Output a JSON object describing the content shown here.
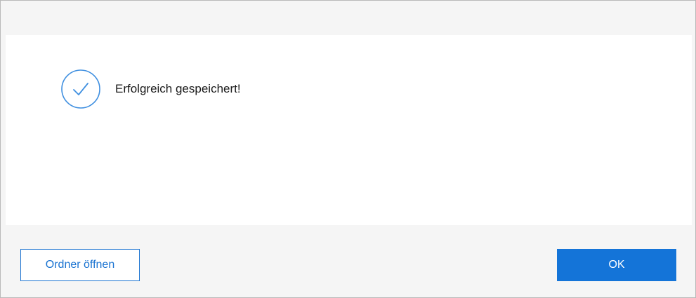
{
  "dialog": {
    "message": "Erfolgreich gespeichert!",
    "status_icon": "checkmark-circle-icon",
    "accent_color": "#1474d8"
  },
  "footer": {
    "open_folder_label": "Ordner öffnen",
    "ok_label": "OK"
  }
}
